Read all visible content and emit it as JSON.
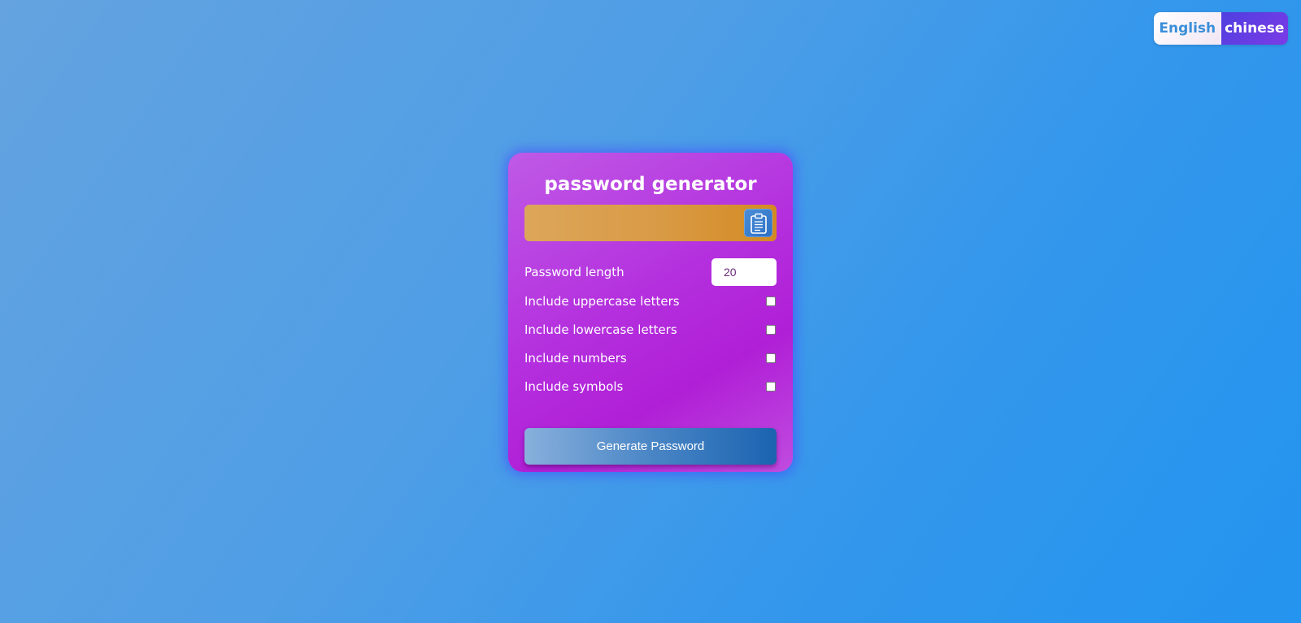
{
  "language_switch": {
    "english_label": "English",
    "chinese_label": "chinese"
  },
  "card": {
    "title": "password generator",
    "result": {
      "value": "",
      "copy_icon": "clipboard-icon"
    },
    "settings": {
      "length_label": "Password length",
      "length_value": "20",
      "uppercase_label": "Include uppercase letters",
      "lowercase_label": "Include lowercase letters",
      "numbers_label": "Include numbers",
      "symbols_label": "Include symbols"
    },
    "generate_label": "Generate Password"
  },
  "colors": {
    "background": "#4f9ee6",
    "card_accent": "#b430de",
    "result_box": "#d99a45",
    "button": "#1b63b0"
  }
}
